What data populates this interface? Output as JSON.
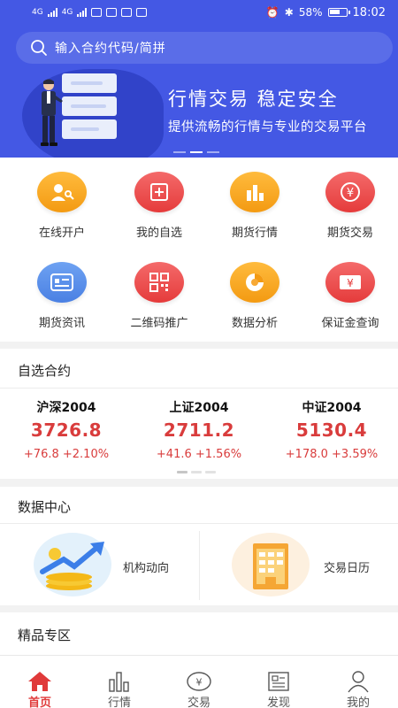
{
  "status_bar": {
    "network_left_1": "4G",
    "network_left_2": "4G",
    "battery_percent": "58%",
    "time": "18:02"
  },
  "search": {
    "placeholder": "输入合约代码/简拼"
  },
  "banner": {
    "title": "行情交易  稳定安全",
    "subtitle": "提供流畅的行情与专业的交易平台",
    "active_slide": 2,
    "slide_count": 3
  },
  "grid": [
    {
      "label": "在线开户",
      "icon": "open-account-icon",
      "color": "orange"
    },
    {
      "label": "我的自选",
      "icon": "add-favorite-icon",
      "color": "red"
    },
    {
      "label": "期货行情",
      "icon": "bar-chart-icon",
      "color": "orange"
    },
    {
      "label": "期货交易",
      "icon": "yen-coin-icon",
      "color": "red"
    },
    {
      "label": "期货资讯",
      "icon": "news-card-icon",
      "color": "blue"
    },
    {
      "label": "二维码推广",
      "icon": "qr-code-icon",
      "color": "red"
    },
    {
      "label": "数据分析",
      "icon": "pie-chart-icon",
      "color": "orange"
    },
    {
      "label": "保证金查询",
      "icon": "yen-ticket-icon",
      "color": "red"
    }
  ],
  "watchlist": {
    "title": "自选合约",
    "quotes": [
      {
        "name": "沪深2004",
        "price": "3726.8",
        "change": "+76.8  +2.10%"
      },
      {
        "name": "上证2004",
        "price": "2711.2",
        "change": "+41.6  +1.56%"
      },
      {
        "name": "中证2004",
        "price": "5130.4",
        "change": "+178.0  +3.59%"
      }
    ]
  },
  "data_center": {
    "title": "数据中心",
    "items": [
      {
        "label": "机构动向",
        "icon": "rising-arrow-coins-icon"
      },
      {
        "label": "交易日历",
        "icon": "calendar-icon"
      }
    ]
  },
  "premium": {
    "title": "精品专区"
  },
  "tabbar": {
    "active": "首页",
    "tabs": [
      {
        "label": "首页",
        "icon": "home-icon"
      },
      {
        "label": "行情",
        "icon": "bar-chart-icon"
      },
      {
        "label": "交易",
        "icon": "yen-circle-icon"
      },
      {
        "label": "发现",
        "icon": "newspaper-icon"
      },
      {
        "label": "我的",
        "icon": "user-icon"
      }
    ]
  },
  "colors": {
    "brand_blue": "#4458e4",
    "accent_red": "#e03a3a",
    "price_red": "#d93c3c",
    "orange": "#f39a12"
  }
}
